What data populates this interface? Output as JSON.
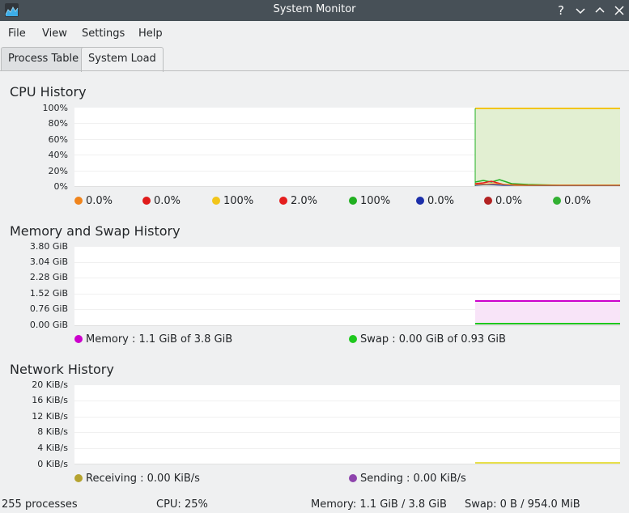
{
  "window": {
    "title": "System Monitor",
    "help_glyph": "?",
    "colors": {
      "titlebar": "#475057"
    }
  },
  "menu": {
    "items": [
      "File",
      "View",
      "Settings",
      "Help"
    ]
  },
  "tabs": [
    {
      "label": "Process Table",
      "active": false
    },
    {
      "label": "System Load",
      "active": true
    }
  ],
  "cpu": {
    "title": "CPU History",
    "yticks": [
      "100%",
      "80%",
      "60%",
      "40%",
      "20%",
      "0%"
    ],
    "legend": [
      {
        "label": "0.0%",
        "color": "#f0841c"
      },
      {
        "label": "0.0%",
        "color": "#e01b1b"
      },
      {
        "label": "100%",
        "color": "#f2c51a"
      },
      {
        "label": "2.0%",
        "color": "#e41e1e"
      },
      {
        "label": "100%",
        "color": "#21b021"
      },
      {
        "label": "0.0%",
        "color": "#1c2faa"
      },
      {
        "label": "0.0%",
        "color": "#b22222"
      },
      {
        "label": "0.0%",
        "color": "#33b133"
      }
    ]
  },
  "memory": {
    "title": "Memory and Swap History",
    "yticks": [
      "3.80 GiB",
      "3.04 GiB",
      "2.28 GiB",
      "1.52 GiB",
      "0.76 GiB",
      "0.00 GiB"
    ],
    "legend": [
      {
        "label": "Memory : 1.1 GiB of 3.8 GiB",
        "color": "#cc00cc"
      },
      {
        "label": "Swap : 0.00 GiB of 0.93 GiB",
        "color": "#1ec81e"
      }
    ]
  },
  "network": {
    "title": "Network History",
    "yticks": [
      "20 KiB/s",
      "16 KiB/s",
      "12 KiB/s",
      "8 KiB/s",
      "4 KiB/s",
      "0 KiB/s"
    ],
    "legend": [
      {
        "label": "Receiving : 0.00 KiB/s",
        "color": "#b5a330"
      },
      {
        "label": "Sending : 0.00 KiB/s",
        "color": "#8e44ad"
      }
    ]
  },
  "status": {
    "processes": "255 processes",
    "cpu": "CPU: 25%",
    "memory": "Memory: 1.1 GiB / 3.8 GiB",
    "swap": "Swap: 0 B / 954.0 MiB"
  }
}
